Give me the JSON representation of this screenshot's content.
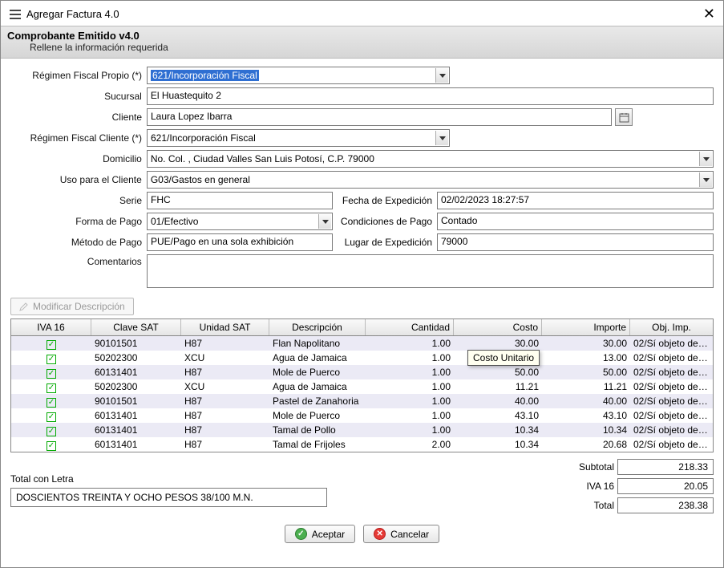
{
  "window": {
    "title": "Agregar Factura 4.0"
  },
  "header": {
    "title": "Comprobante Emitido v4.0",
    "subtitle": "Rellene la información requerida"
  },
  "labels": {
    "regimen_propio": "Régimen Fiscal Propio (*)",
    "sucursal": "Sucursal",
    "cliente": "Cliente",
    "regimen_cliente": "Régimen Fiscal Cliente (*)",
    "domicilio": "Domicilio",
    "uso_cliente": "Uso para el Cliente",
    "serie": "Serie",
    "fecha_exp": "Fecha de Expedición",
    "forma_pago": "Forma de Pago",
    "cond_pago": "Condiciones de Pago",
    "metodo_pago": "Método de Pago",
    "lugar_exp": "Lugar de Expedición",
    "comentarios": "Comentarios",
    "mod_desc": "Modificar Descripción",
    "subtotal": "Subtotal",
    "iva16": "IVA 16",
    "total": "Total",
    "total_letra": "Total con Letra",
    "aceptar": "Aceptar",
    "cancelar": "Cancelar"
  },
  "values": {
    "regimen_propio": "621/Incorporación Fiscal",
    "sucursal": "El Huastequito 2",
    "cliente": "Laura Lopez Ibarra",
    "regimen_cliente": "621/Incorporación Fiscal",
    "domicilio": "No.  Col. , Ciudad Valles San Luis Potosí, C.P. 79000",
    "uso_cliente": "G03/Gastos en general",
    "serie": "FHC",
    "fecha_exp": "02/02/2023 18:27:57",
    "forma_pago": "01/Efectivo",
    "cond_pago": "Contado",
    "metodo_pago": "PUE/Pago en una sola exhibición",
    "lugar_exp": "79000",
    "comentarios": ""
  },
  "tooltip": "Costo Unitario",
  "columns": {
    "iva": "IVA 16",
    "csat": "Clave SAT",
    "usat": "Unidad SAT",
    "desc": "Descripción",
    "cant": "Cantidad",
    "costo": "Costo",
    "imp": "Importe",
    "obj": "Obj. Imp."
  },
  "rows": [
    {
      "iva": true,
      "csat": "90101501",
      "usat": "H87",
      "desc": "Flan Napolitano",
      "cant": "1.00",
      "costo": "30.00",
      "imp": "30.00",
      "obj": "02/Sí objeto de im..."
    },
    {
      "iva": true,
      "csat": "50202300",
      "usat": "XCU",
      "desc": "Agua de Jamaica",
      "cant": "1.00",
      "costo": "",
      "imp": "13.00",
      "obj": "02/Sí objeto de im..."
    },
    {
      "iva": true,
      "csat": "60131401",
      "usat": "H87",
      "desc": "Mole de Puerco",
      "cant": "1.00",
      "costo": "50.00",
      "imp": "50.00",
      "obj": "02/Sí objeto de im..."
    },
    {
      "iva": true,
      "csat": "50202300",
      "usat": "XCU",
      "desc": "Agua de Jamaica",
      "cant": "1.00",
      "costo": "11.21",
      "imp": "11.21",
      "obj": "02/Sí objeto de im..."
    },
    {
      "iva": true,
      "csat": "90101501",
      "usat": "H87",
      "desc": "Pastel de Zanahoria",
      "cant": "1.00",
      "costo": "40.00",
      "imp": "40.00",
      "obj": "02/Sí objeto de im..."
    },
    {
      "iva": true,
      "csat": "60131401",
      "usat": "H87",
      "desc": "Mole de Puerco",
      "cant": "1.00",
      "costo": "43.10",
      "imp": "43.10",
      "obj": "02/Sí objeto de im..."
    },
    {
      "iva": true,
      "csat": "60131401",
      "usat": "H87",
      "desc": "Tamal de Pollo",
      "cant": "1.00",
      "costo": "10.34",
      "imp": "10.34",
      "obj": "02/Sí objeto de im..."
    },
    {
      "iva": true,
      "csat": "60131401",
      "usat": "H87",
      "desc": "Tamal de Frijoles",
      "cant": "2.00",
      "costo": "10.34",
      "imp": "20.68",
      "obj": "02/Sí objeto de im..."
    }
  ],
  "totals": {
    "subtotal": "218.33",
    "iva16": "20.05",
    "total": "238.38",
    "letra": "DOSCIENTOS TREINTA Y OCHO PESOS 38/100 M.N."
  }
}
